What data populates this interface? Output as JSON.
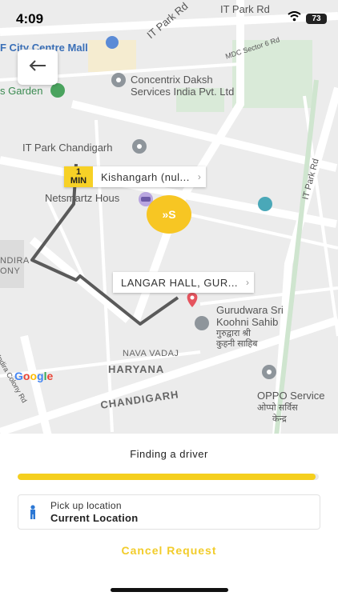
{
  "status_bar": {
    "time": "4:09",
    "battery": "73"
  },
  "map": {
    "labels": {
      "it_park_rd_top": "IT Park Rd",
      "city_centre_mall": "F City Centre Mall",
      "s_garden": "s Garden",
      "concentrix": "Concentrix Daksh",
      "concentrix2": "Services India Pvt. Ltd",
      "mdc_sector": "MDC Sector 6 Rd",
      "it_park_chandigarh": "IT Park Chandigarh",
      "netsmartz": "Netsmartz Hous",
      "it_park_rd_right": "IT Park Rd",
      "indira_colony": "NDIRA",
      "indira_colony2": "ONY",
      "gurudwara": "Gurudwara Sri",
      "gurudwara2": "Koohni Sahib",
      "gurudwara3": "गुरुद्वारा श्री",
      "gurudwara4": "कुहनी साहिब",
      "indira_colony_rd": "Indira Colony Rd",
      "nava_vadaj": "NAVA VADAJ",
      "haryana": "HARYANA",
      "chandigarh": "CHANDIGARH",
      "oppo": "OPPO Service",
      "oppo2": "ओप्पो सर्विस",
      "oppo3": "केन्द्र",
      "google": "Google"
    },
    "pickup_callout": {
      "eta_value": "1",
      "eta_unit": "MIN",
      "text": "Kishangarh (nul..."
    },
    "drop_callout": {
      "text": "LANGAR HALL, GUR..."
    },
    "driver_bubble": "»S"
  },
  "sheet": {
    "status": "Finding a driver",
    "progress": 0.99,
    "pickup_label": "Pick up location",
    "pickup_value": "Current Location",
    "cancel": "Cancel Request"
  },
  "colors": {
    "accent": "#f5cf1e",
    "route": "#555555",
    "pin": "#e5545e"
  }
}
